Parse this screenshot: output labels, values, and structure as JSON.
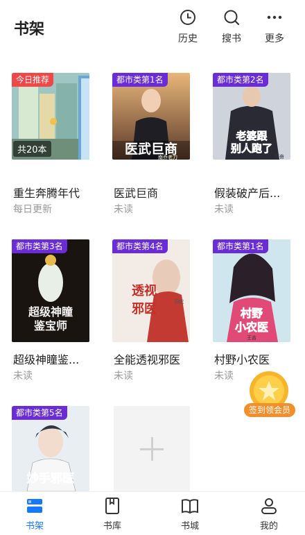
{
  "header": {
    "title": "书架",
    "history_label": "历史",
    "search_label": "搜书",
    "more_label": "更多"
  },
  "books": [
    {
      "title": "重生奔腾年代",
      "sub": "每日更新",
      "badge": "今日推荐",
      "count": "共20本"
    },
    {
      "title": "医武巨商",
      "sub": "未读",
      "badge": "都市类第1名",
      "cover_text": "医武巨商",
      "author": "南乔老刀"
    },
    {
      "title": "假装破产后...",
      "sub": "未读",
      "badge": "都市类第2名",
      "cover_text": "老婆跟别人跑了",
      "author": "振奋"
    },
    {
      "title": "超级神瞳鉴...",
      "sub": "未读",
      "badge": "都市类第3名",
      "cover_text": "超级神瞳鉴宝师"
    },
    {
      "title": "全能透视邪医",
      "sub": "未读",
      "badge": "都市类第4名",
      "cover_text": "透视邪医",
      "author": "羽蛇"
    },
    {
      "title": "村野小农医",
      "sub": "未读",
      "badge": "都市类第1名",
      "cover_text": "村野小农医",
      "author": "王吉"
    },
    {
      "badge": "都市类第5名",
      "cover_text": "妙手邪医"
    }
  ],
  "signin": {
    "label": "签到领会员"
  },
  "tabs": [
    {
      "label": "书架"
    },
    {
      "label": "书库"
    },
    {
      "label": "书城"
    },
    {
      "label": "我的"
    }
  ],
  "colors": {
    "accent": "#1677ff",
    "badge_purple": "#6a2bd8",
    "badge_red": "#f04848",
    "signin": "#f38f2a"
  }
}
